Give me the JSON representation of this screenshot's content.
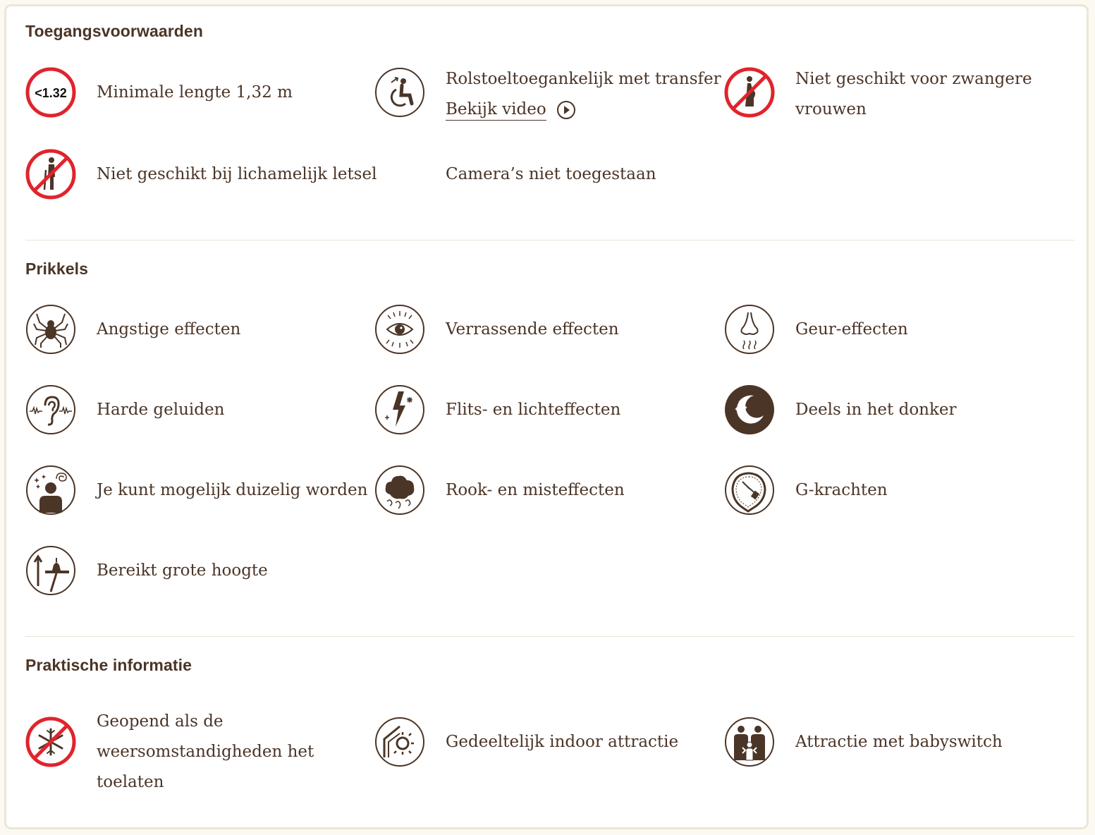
{
  "sections": [
    {
      "title": "Toegangsvoorwaarden",
      "items": [
        {
          "icon": "height-restriction-icon",
          "badge": "<1.32",
          "lines": [
            "Minimale lengte 1,32 m"
          ]
        },
        {
          "icon": "wheelchair-transfer-icon",
          "lines": [
            "Rolstoeltoegankelijk met transfer"
          ],
          "link": "Bekijk video",
          "link_icon": "play-icon"
        },
        {
          "icon": "no-pregnant-icon",
          "lines": [
            "Niet geschikt voor zwangere",
            "vrouwen"
          ]
        },
        {
          "icon": "no-injury-icon",
          "lines": [
            "Niet geschikt bij lichamelijk letsel"
          ]
        },
        {
          "icon": "",
          "lines": [
            "Camera’s niet toegestaan"
          ]
        }
      ]
    },
    {
      "title": "Prikkels",
      "items": [
        {
          "icon": "spider-icon",
          "lines": [
            "Angstige effecten"
          ]
        },
        {
          "icon": "eye-surprise-icon",
          "lines": [
            "Verrassende effecten"
          ]
        },
        {
          "icon": "nose-smell-icon",
          "lines": [
            "Geur-effecten"
          ]
        },
        {
          "icon": "ear-sound-icon",
          "lines": [
            "Harde geluiden"
          ]
        },
        {
          "icon": "lightning-flash-icon",
          "lines": [
            "Flits- en lichteffecten"
          ]
        },
        {
          "icon": "moon-dark-icon",
          "lines": [
            "Deels in het donker"
          ]
        },
        {
          "icon": "dizzy-person-icon",
          "lines": [
            "Je kunt mogelijk duizelig worden"
          ]
        },
        {
          "icon": "smoke-mist-icon",
          "lines": [
            "Rook- en misteffecten"
          ]
        },
        {
          "icon": "g-force-icon",
          "lines": [
            "G-krachten"
          ]
        },
        {
          "icon": "height-tower-icon",
          "lines": [
            "Bereikt grote hoogte"
          ]
        }
      ]
    },
    {
      "title": "Praktische informatie",
      "items": [
        {
          "icon": "no-frost-weather-icon",
          "lines": [
            "Geopend als de",
            "weersomstandigheden het",
            "toelaten"
          ]
        },
        {
          "icon": "partial-indoor-icon",
          "lines": [
            "Gedeeltelijk indoor attractie"
          ]
        },
        {
          "icon": "babyswitch-icon",
          "lines": [
            "Attractie met babyswitch"
          ]
        }
      ]
    }
  ],
  "colors": {
    "text": "#4b3527",
    "prohibited_red": "#e0242c",
    "divider": "#e9e4d6",
    "background": "#fbf9f1"
  }
}
